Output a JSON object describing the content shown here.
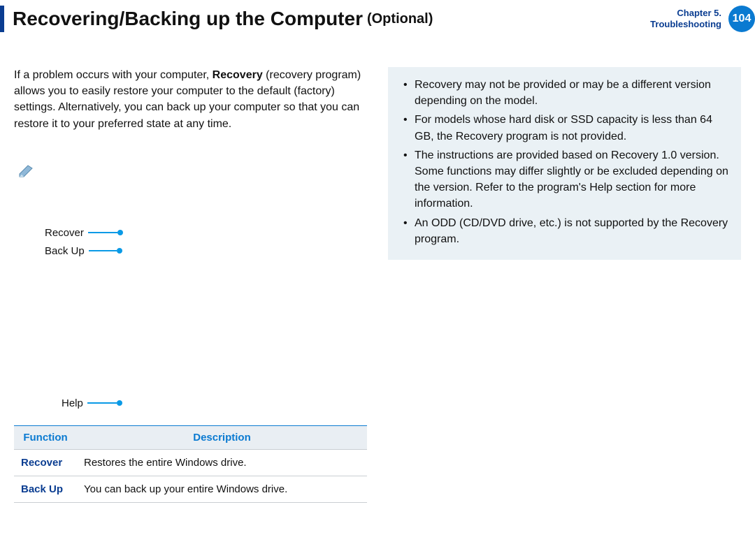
{
  "header": {
    "title_main": "Recovering/Backing up the Computer",
    "title_optional": "(Optional)",
    "chapter_line1": "Chapter 5.",
    "chapter_line2": "Troubleshooting",
    "page_number": "104"
  },
  "intro": {
    "part1": "If a problem occurs with your computer, ",
    "bold": "Recovery",
    "part2": " (recovery program) allows you to easily restore your computer to the default (factory) settings. Alternatively, you can back up your computer so that you can restore it to your preferred state at any time."
  },
  "callouts": {
    "recover": "Recover",
    "backup": "Back Up",
    "help": "Help"
  },
  "table": {
    "headers": {
      "function": "Function",
      "description": "Description"
    },
    "rows": [
      {
        "name": "Recover",
        "desc": "Restores the entire Windows drive."
      },
      {
        "name": "Back Up",
        "desc": "You can back up your entire Windows drive."
      }
    ]
  },
  "notes": {
    "items": [
      "Recovery may not be provided or may be a different version depending on the model.",
      "For models whose hard disk or SSD capacity is less than 64 GB, the Recovery program is not provided.",
      "The instructions are provided based on Recovery 1.0 version. Some functions may differ slightly or be excluded depending on the version. Refer to the program's Help section for more information.",
      "An ODD (CD/DVD drive, etc.) is not supported by the Recovery program."
    ]
  }
}
